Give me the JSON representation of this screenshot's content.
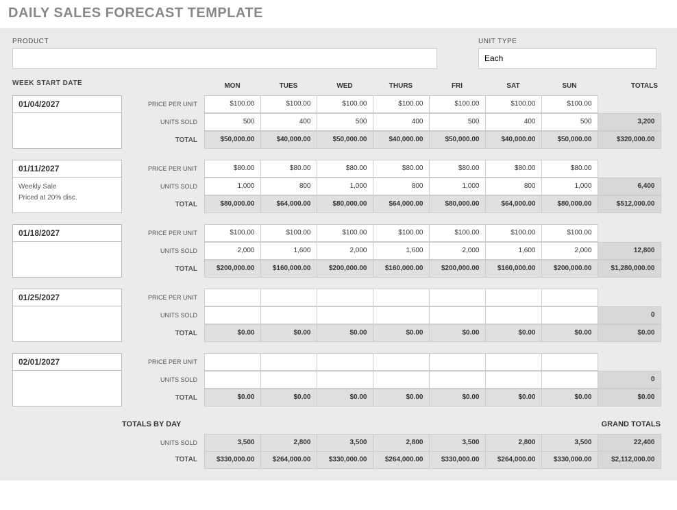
{
  "title": "DAILY SALES FORECAST TEMPLATE",
  "labels": {
    "product": "PRODUCT",
    "unit_type": "UNIT TYPE",
    "week_start": "WEEK START DATE",
    "price_per_unit": "PRICE PER UNIT",
    "units_sold": "UNITS SOLD",
    "total": "TOTAL",
    "totals": "TOTALS",
    "totals_by_day": "TOTALS BY DAY",
    "grand_totals": "GRAND TOTALS"
  },
  "inputs": {
    "product": "",
    "unit_type": "Each"
  },
  "days": [
    "MON",
    "TUES",
    "WED",
    "THURS",
    "FRI",
    "SAT",
    "SUN"
  ],
  "weeks": [
    {
      "date": "01/04/2027",
      "notes": "",
      "price": [
        "$100.00",
        "$100.00",
        "$100.00",
        "$100.00",
        "$100.00",
        "$100.00",
        "$100.00"
      ],
      "units": [
        "500",
        "400",
        "500",
        "400",
        "500",
        "400",
        "500"
      ],
      "units_total": "3,200",
      "totals": [
        "$50,000.00",
        "$40,000.00",
        "$50,000.00",
        "$40,000.00",
        "$50,000.00",
        "$40,000.00",
        "$50,000.00"
      ],
      "row_total": "$320,000.00"
    },
    {
      "date": "01/11/2027",
      "notes": "Weekly Sale\nPriced at 20% disc.",
      "price": [
        "$80.00",
        "$80.00",
        "$80.00",
        "$80.00",
        "$80.00",
        "$80.00",
        "$80.00"
      ],
      "units": [
        "1,000",
        "800",
        "1,000",
        "800",
        "1,000",
        "800",
        "1,000"
      ],
      "units_total": "6,400",
      "totals": [
        "$80,000.00",
        "$64,000.00",
        "$80,000.00",
        "$64,000.00",
        "$80,000.00",
        "$64,000.00",
        "$80,000.00"
      ],
      "row_total": "$512,000.00"
    },
    {
      "date": "01/18/2027",
      "notes": "",
      "price": [
        "$100.00",
        "$100.00",
        "$100.00",
        "$100.00",
        "$100.00",
        "$100.00",
        "$100.00"
      ],
      "units": [
        "2,000",
        "1,600",
        "2,000",
        "1,600",
        "2,000",
        "1,600",
        "2,000"
      ],
      "units_total": "12,800",
      "totals": [
        "$200,000.00",
        "$160,000.00",
        "$200,000.00",
        "$160,000.00",
        "$200,000.00",
        "$160,000.00",
        "$200,000.00"
      ],
      "row_total": "$1,280,000.00"
    },
    {
      "date": "01/25/2027",
      "notes": "",
      "price": [
        "",
        "",
        "",
        "",
        "",
        "",
        ""
      ],
      "units": [
        "",
        "",
        "",
        "",
        "",
        "",
        ""
      ],
      "units_total": "0",
      "totals": [
        "$0.00",
        "$0.00",
        "$0.00",
        "$0.00",
        "$0.00",
        "$0.00",
        "$0.00"
      ],
      "row_total": "$0.00"
    },
    {
      "date": "02/01/2027",
      "notes": "",
      "price": [
        "",
        "",
        "",
        "",
        "",
        "",
        ""
      ],
      "units": [
        "",
        "",
        "",
        "",
        "",
        "",
        ""
      ],
      "units_total": "0",
      "totals": [
        "$0.00",
        "$0.00",
        "$0.00",
        "$0.00",
        "$0.00",
        "$0.00",
        "$0.00"
      ],
      "row_total": "$0.00"
    }
  ],
  "day_totals": {
    "units": [
      "3,500",
      "2,800",
      "3,500",
      "2,800",
      "3,500",
      "2,800",
      "3,500"
    ],
    "units_total": "22,400",
    "totals": [
      "$330,000.00",
      "$264,000.00",
      "$330,000.00",
      "$264,000.00",
      "$330,000.00",
      "$264,000.00",
      "$330,000.00"
    ],
    "grand_total": "$2,112,000.00"
  }
}
